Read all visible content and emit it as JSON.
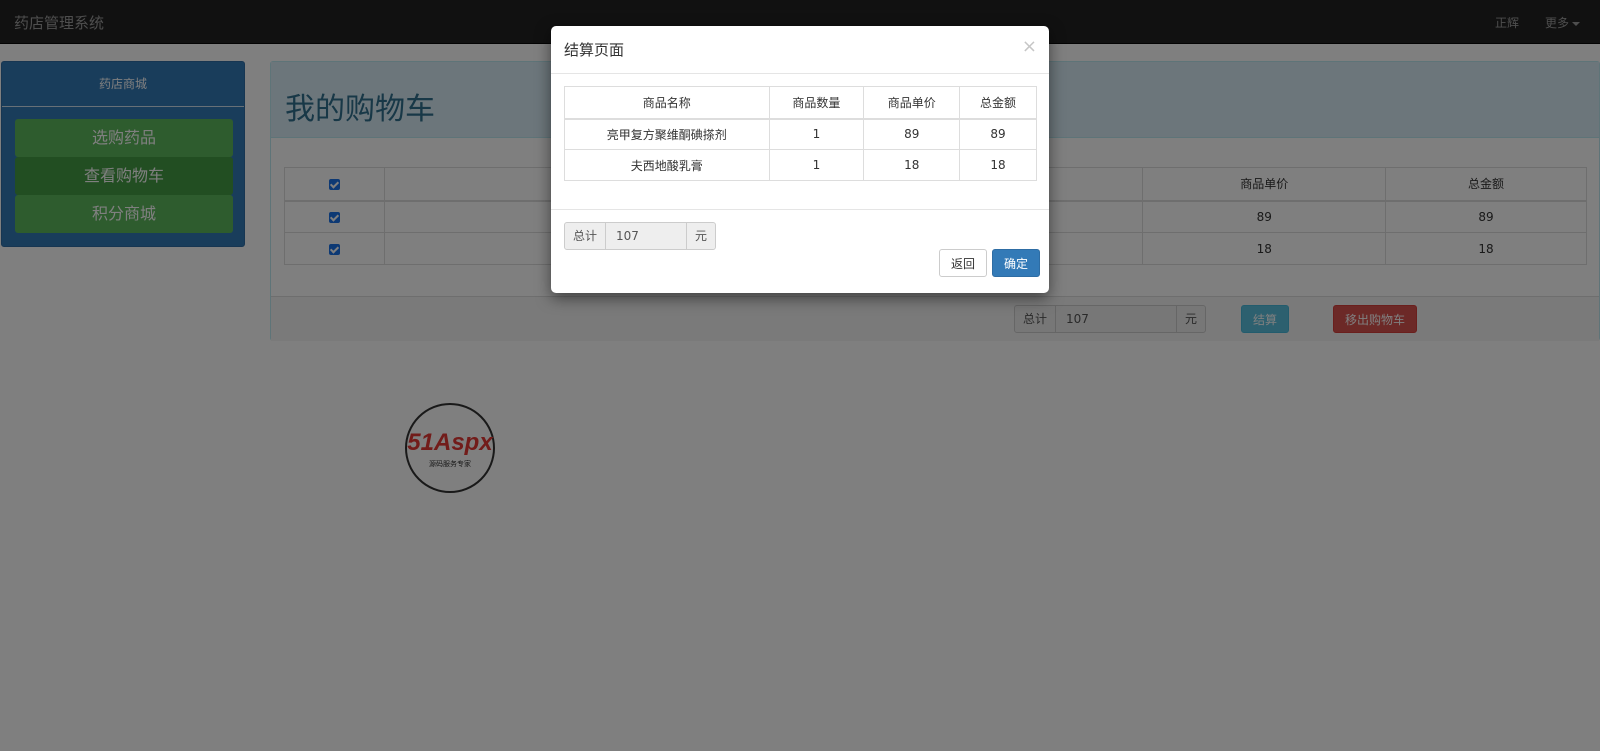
{
  "navbar": {
    "brand": "药店管理系统",
    "user": "正辉",
    "more": "更多"
  },
  "sidebar": {
    "title": "药店商城",
    "items": [
      {
        "label": "选购药品"
      },
      {
        "label": "查看购物车"
      },
      {
        "label": "积分商城"
      }
    ]
  },
  "main": {
    "title": "我的购物车",
    "table": {
      "headers": [
        "商品单价",
        "总金额"
      ],
      "rows": [
        {
          "price": "89",
          "total": "89"
        },
        {
          "price": "18",
          "total": "18"
        }
      ]
    },
    "total": {
      "label": "总计",
      "value": "107",
      "unit": "元"
    },
    "checkout_label": "结算",
    "remove_label": "移出购物车"
  },
  "modal": {
    "title": "结算页面",
    "close": "×",
    "table": {
      "headers": [
        "商品名称",
        "商品数量",
        "商品单价",
        "总金额"
      ],
      "rows": [
        {
          "name": "亮甲复方聚维酮碘搽剂",
          "qty": "1",
          "price": "89",
          "total": "89"
        },
        {
          "name": "夫西地酸乳膏",
          "qty": "1",
          "price": "18",
          "total": "18"
        }
      ]
    },
    "total": {
      "label": "总计",
      "value": "107",
      "unit": "元"
    },
    "back_label": "返回",
    "confirm_label": "确定"
  },
  "watermark": {
    "text": "51Aspx",
    "subtitle": "源码服务专家"
  },
  "colors": {
    "navbar": "#222222",
    "primary": "#337ab7",
    "success": "#5cb85c",
    "info": "#5bc0de",
    "danger": "#d9534f"
  }
}
